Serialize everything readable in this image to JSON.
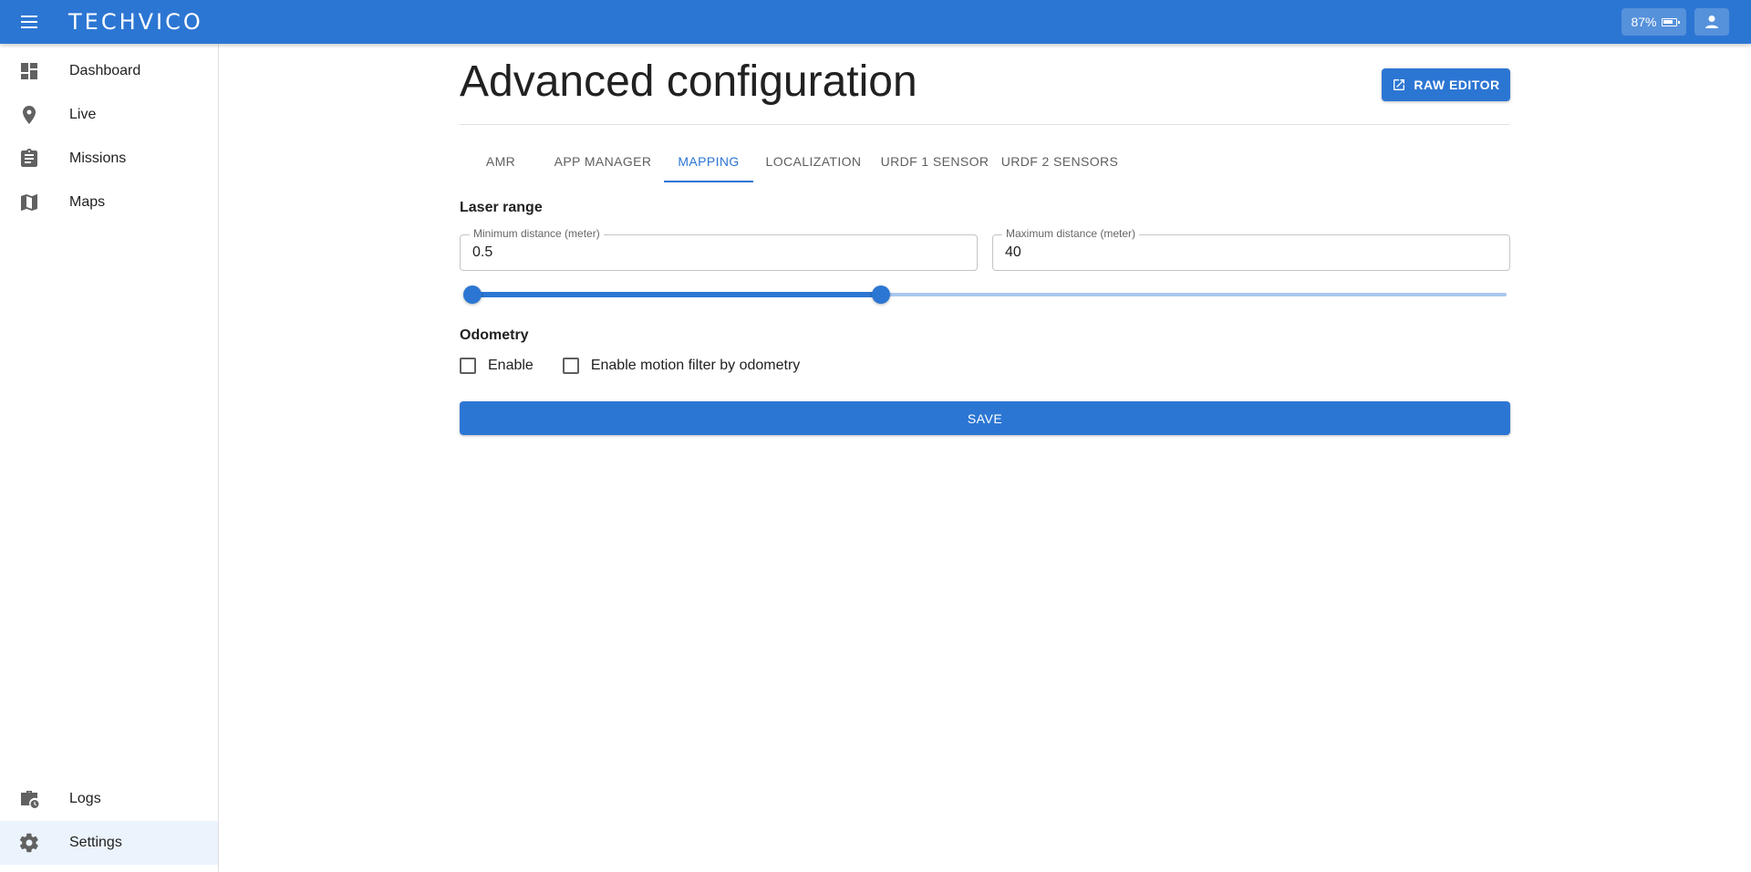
{
  "appbar": {
    "brand": "TECHVICO",
    "battery_label": "87%",
    "battery_level": 0.87,
    "icons": {
      "menu": "menu-icon",
      "battery": "battery-icon",
      "user": "account-icon"
    }
  },
  "sidebar": {
    "items": [
      {
        "label": "Dashboard",
        "icon": "dashboard-icon",
        "active": false
      },
      {
        "label": "Live",
        "icon": "location-pin-icon",
        "active": false
      },
      {
        "label": "Missions",
        "icon": "clipboard-icon",
        "active": false
      },
      {
        "label": "Maps",
        "icon": "map-icon",
        "active": false
      },
      {
        "label": "Logs",
        "icon": "logs-icon",
        "active": false
      },
      {
        "label": "Settings",
        "icon": "gear-icon",
        "active": true
      }
    ]
  },
  "main": {
    "title": "Advanced configuration",
    "raw_editor_label": "RAW EDITOR",
    "tabs": [
      {
        "label": "AMR",
        "active": false
      },
      {
        "label": "APP MANAGER",
        "active": false
      },
      {
        "label": "MAPPING",
        "active": true
      },
      {
        "label": "LOCALIZATION",
        "active": false
      },
      {
        "label": "URDF 1 SENSOR",
        "active": false
      },
      {
        "label": "URDF 2 SENSORS",
        "active": false
      }
    ],
    "laser_range": {
      "heading": "Laser range",
      "min_label": "Minimum distance (meter)",
      "min_value": "0.5",
      "max_label": "Maximum distance (meter)",
      "max_value": "40",
      "slider_min_fraction": 0.0,
      "slider_max_fraction": 0.395
    },
    "odometry": {
      "heading": "Odometry",
      "enable_label": "Enable",
      "enable_checked": false,
      "motion_filter_label": "Enable motion filter by odometry",
      "motion_filter_checked": false
    },
    "save_label": "SAVE"
  },
  "colors": {
    "primary": "#2c76d3",
    "active_bg": "#ebf3fc"
  }
}
